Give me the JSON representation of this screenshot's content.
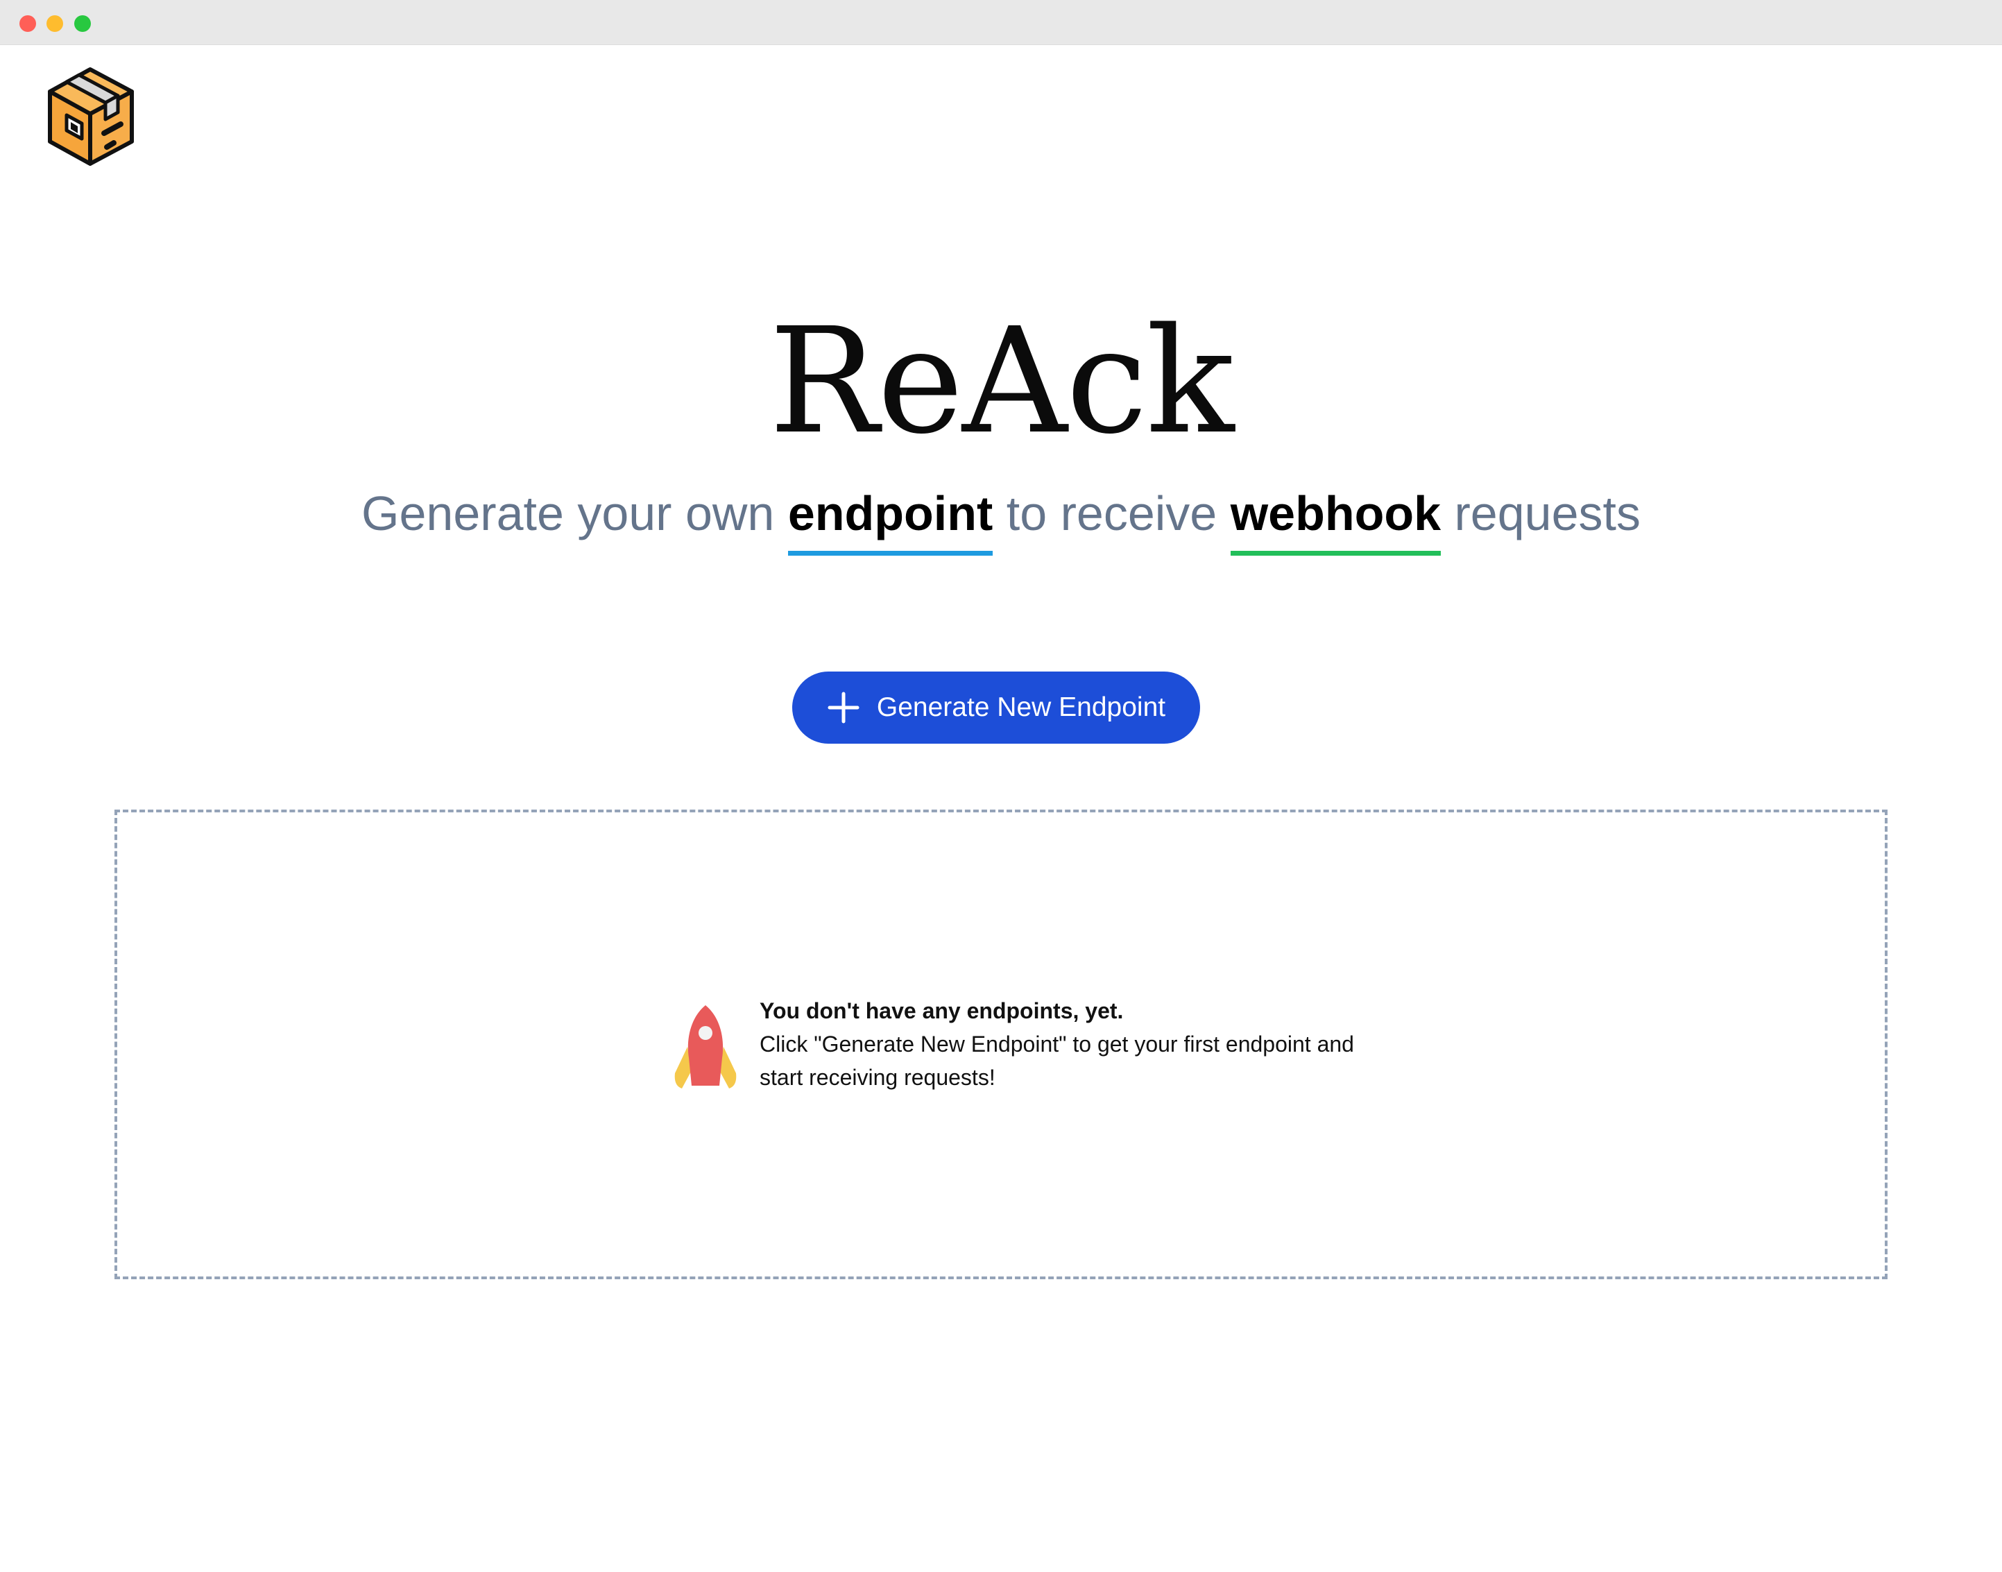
{
  "window": {
    "controls": [
      "close",
      "minimize",
      "zoom"
    ]
  },
  "logo": {
    "icon": "package-box-icon",
    "colors": {
      "box": "#f6a53b",
      "tape": "#d9d9d9",
      "outline": "#111111"
    }
  },
  "hero": {
    "title": "ReAck",
    "subtitle": {
      "part1": "Generate your own ",
      "keyword1": "endpoint",
      "part2": " to receive ",
      "keyword2": "webhook",
      "part3": " requests"
    },
    "underline_colors": {
      "endpoint": "#1e9be0",
      "webhook": "#22bf5a"
    }
  },
  "generate_button": {
    "icon": "plus-icon",
    "label": "Generate New Endpoint",
    "color": "#1d4ed8"
  },
  "empty_state": {
    "icon": "rocket-icon",
    "heading": "You don't have any endpoints, yet.",
    "body": "Click \"Generate New Endpoint\" to get your first endpoint and start receiving requests!"
  }
}
